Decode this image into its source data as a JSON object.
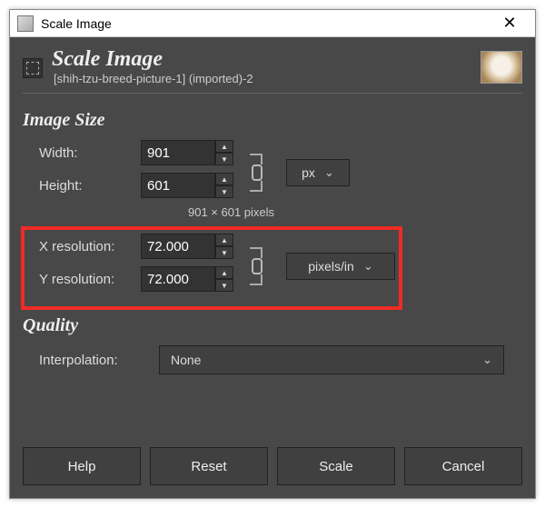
{
  "window": {
    "title": "Scale Image"
  },
  "header": {
    "title": "Scale Image",
    "subtitle": "[shih-tzu-breed-picture-1] (imported)-2"
  },
  "sections": {
    "image_size": "Image Size",
    "quality": "Quality"
  },
  "size": {
    "width": {
      "label": "Width:",
      "value": "901"
    },
    "height": {
      "label": "Height:",
      "value": "601"
    },
    "unit": "px",
    "caption": "901 × 601 pixels"
  },
  "resolution": {
    "x": {
      "label": "X resolution:",
      "value": "72.000"
    },
    "y": {
      "label": "Y resolution:",
      "value": "72.000"
    },
    "unit": "pixels/in"
  },
  "quality": {
    "interpolation": {
      "label": "Interpolation:",
      "value": "None"
    }
  },
  "buttons": {
    "help": "Help",
    "reset": "Reset",
    "scale": "Scale",
    "cancel": "Cancel"
  },
  "colors": {
    "highlight": "#ef2b25",
    "bg": "#484848",
    "input_bg": "#333333"
  }
}
